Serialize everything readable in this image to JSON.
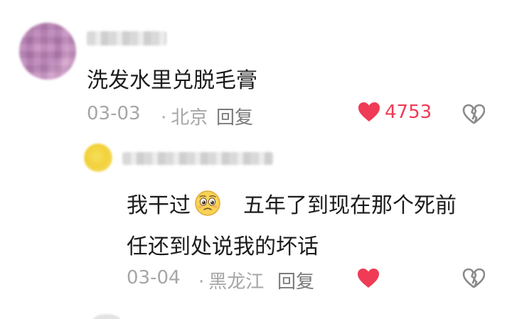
{
  "comments": [
    {
      "text": "洗发水里兑脱毛膏",
      "date": "03-03",
      "location": "北京",
      "reply_label": "回复",
      "like_count": "4753",
      "liked": true
    },
    {
      "text_line1_a": "我干过",
      "text_line1_b": "五年了到现在那个死前",
      "text_line2": "任还到处说我的坏话",
      "emoji": "pleading-face",
      "date": "03-04",
      "location": "黑龙江",
      "reply_label": "回复",
      "liked": true
    }
  ],
  "colors": {
    "like_red": "#ef3b55",
    "meta_gray": "#a6a6a6"
  },
  "icons": {
    "like": "heart-icon",
    "dislike": "broken-heart-icon"
  }
}
